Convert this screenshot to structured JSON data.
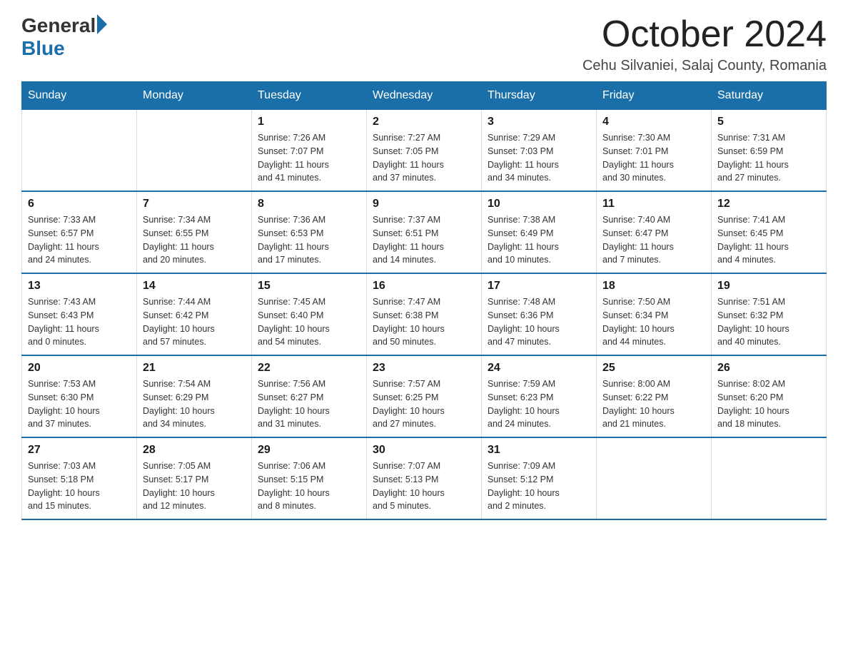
{
  "logo": {
    "general": "General",
    "blue": "Blue"
  },
  "title": "October 2024",
  "subtitle": "Cehu Silvaniei, Salaj County, Romania",
  "weekdays": [
    "Sunday",
    "Monday",
    "Tuesday",
    "Wednesday",
    "Thursday",
    "Friday",
    "Saturday"
  ],
  "weeks": [
    [
      {
        "day": "",
        "info": ""
      },
      {
        "day": "",
        "info": ""
      },
      {
        "day": "1",
        "info": "Sunrise: 7:26 AM\nSunset: 7:07 PM\nDaylight: 11 hours\nand 41 minutes."
      },
      {
        "day": "2",
        "info": "Sunrise: 7:27 AM\nSunset: 7:05 PM\nDaylight: 11 hours\nand 37 minutes."
      },
      {
        "day": "3",
        "info": "Sunrise: 7:29 AM\nSunset: 7:03 PM\nDaylight: 11 hours\nand 34 minutes."
      },
      {
        "day": "4",
        "info": "Sunrise: 7:30 AM\nSunset: 7:01 PM\nDaylight: 11 hours\nand 30 minutes."
      },
      {
        "day": "5",
        "info": "Sunrise: 7:31 AM\nSunset: 6:59 PM\nDaylight: 11 hours\nand 27 minutes."
      }
    ],
    [
      {
        "day": "6",
        "info": "Sunrise: 7:33 AM\nSunset: 6:57 PM\nDaylight: 11 hours\nand 24 minutes."
      },
      {
        "day": "7",
        "info": "Sunrise: 7:34 AM\nSunset: 6:55 PM\nDaylight: 11 hours\nand 20 minutes."
      },
      {
        "day": "8",
        "info": "Sunrise: 7:36 AM\nSunset: 6:53 PM\nDaylight: 11 hours\nand 17 minutes."
      },
      {
        "day": "9",
        "info": "Sunrise: 7:37 AM\nSunset: 6:51 PM\nDaylight: 11 hours\nand 14 minutes."
      },
      {
        "day": "10",
        "info": "Sunrise: 7:38 AM\nSunset: 6:49 PM\nDaylight: 11 hours\nand 10 minutes."
      },
      {
        "day": "11",
        "info": "Sunrise: 7:40 AM\nSunset: 6:47 PM\nDaylight: 11 hours\nand 7 minutes."
      },
      {
        "day": "12",
        "info": "Sunrise: 7:41 AM\nSunset: 6:45 PM\nDaylight: 11 hours\nand 4 minutes."
      }
    ],
    [
      {
        "day": "13",
        "info": "Sunrise: 7:43 AM\nSunset: 6:43 PM\nDaylight: 11 hours\nand 0 minutes."
      },
      {
        "day": "14",
        "info": "Sunrise: 7:44 AM\nSunset: 6:42 PM\nDaylight: 10 hours\nand 57 minutes."
      },
      {
        "day": "15",
        "info": "Sunrise: 7:45 AM\nSunset: 6:40 PM\nDaylight: 10 hours\nand 54 minutes."
      },
      {
        "day": "16",
        "info": "Sunrise: 7:47 AM\nSunset: 6:38 PM\nDaylight: 10 hours\nand 50 minutes."
      },
      {
        "day": "17",
        "info": "Sunrise: 7:48 AM\nSunset: 6:36 PM\nDaylight: 10 hours\nand 47 minutes."
      },
      {
        "day": "18",
        "info": "Sunrise: 7:50 AM\nSunset: 6:34 PM\nDaylight: 10 hours\nand 44 minutes."
      },
      {
        "day": "19",
        "info": "Sunrise: 7:51 AM\nSunset: 6:32 PM\nDaylight: 10 hours\nand 40 minutes."
      }
    ],
    [
      {
        "day": "20",
        "info": "Sunrise: 7:53 AM\nSunset: 6:30 PM\nDaylight: 10 hours\nand 37 minutes."
      },
      {
        "day": "21",
        "info": "Sunrise: 7:54 AM\nSunset: 6:29 PM\nDaylight: 10 hours\nand 34 minutes."
      },
      {
        "day": "22",
        "info": "Sunrise: 7:56 AM\nSunset: 6:27 PM\nDaylight: 10 hours\nand 31 minutes."
      },
      {
        "day": "23",
        "info": "Sunrise: 7:57 AM\nSunset: 6:25 PM\nDaylight: 10 hours\nand 27 minutes."
      },
      {
        "day": "24",
        "info": "Sunrise: 7:59 AM\nSunset: 6:23 PM\nDaylight: 10 hours\nand 24 minutes."
      },
      {
        "day": "25",
        "info": "Sunrise: 8:00 AM\nSunset: 6:22 PM\nDaylight: 10 hours\nand 21 minutes."
      },
      {
        "day": "26",
        "info": "Sunrise: 8:02 AM\nSunset: 6:20 PM\nDaylight: 10 hours\nand 18 minutes."
      }
    ],
    [
      {
        "day": "27",
        "info": "Sunrise: 7:03 AM\nSunset: 5:18 PM\nDaylight: 10 hours\nand 15 minutes."
      },
      {
        "day": "28",
        "info": "Sunrise: 7:05 AM\nSunset: 5:17 PM\nDaylight: 10 hours\nand 12 minutes."
      },
      {
        "day": "29",
        "info": "Sunrise: 7:06 AM\nSunset: 5:15 PM\nDaylight: 10 hours\nand 8 minutes."
      },
      {
        "day": "30",
        "info": "Sunrise: 7:07 AM\nSunset: 5:13 PM\nDaylight: 10 hours\nand 5 minutes."
      },
      {
        "day": "31",
        "info": "Sunrise: 7:09 AM\nSunset: 5:12 PM\nDaylight: 10 hours\nand 2 minutes."
      },
      {
        "day": "",
        "info": ""
      },
      {
        "day": "",
        "info": ""
      }
    ]
  ]
}
